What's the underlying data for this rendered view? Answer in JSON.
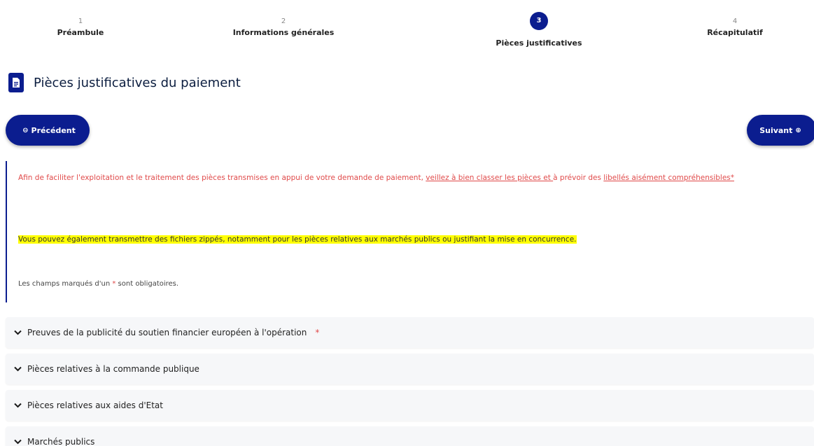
{
  "stepper": {
    "steps": [
      {
        "num": "1",
        "label": "Préambule"
      },
      {
        "num": "2",
        "label": "Informations générales"
      },
      {
        "num": "3",
        "label": "Pièces justificatives"
      },
      {
        "num": "4",
        "label": "Récapitulatif"
      }
    ],
    "active_step": 3
  },
  "section": {
    "icon": "document-icon",
    "title": "Pièces justificatives du paiement"
  },
  "nav": {
    "prev_label": "Précédent",
    "next_label": "Suivant",
    "prev_icon": "⊖",
    "next_icon": "⊕"
  },
  "info": {
    "p1_start": "Afin de faciliter l'exploitation et le traitement des pièces transmises en appui de votre demande de paiement, ",
    "p1_u1": "veillez à bien classer les pièces et ",
    "p1_mid": "à prévoir des ",
    "p1_u2": "libellés aisément compréhensibles*",
    "p2": "Vous pouvez également transmettre des fichiers zippés, notamment pour les pièces relatives aux marchés publics ou justifiant la mise en concurrence.",
    "p3_start": "Les champs marqués d'un ",
    "p3_star": "*",
    "p3_end": " sont obligatoires."
  },
  "accordion": {
    "items": [
      {
        "title": "Preuves de la publicité du soutien financier européen à l'opération",
        "required": "*"
      },
      {
        "title": "Pièces relatives à la commande publique"
      },
      {
        "title": "Pièces relatives aux aides d'Etat"
      },
      {
        "title": "Marchés publics"
      }
    ]
  },
  "colors": {
    "primary": "#0b1d8f",
    "warning_text": "#e04a4a",
    "highlight": "#ffff00"
  }
}
